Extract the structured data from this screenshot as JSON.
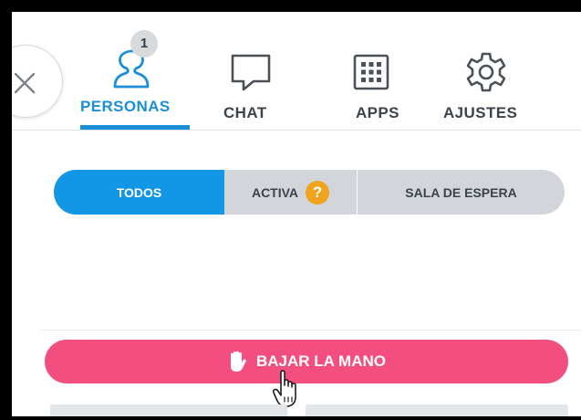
{
  "tabs": [
    {
      "label": "PERSONAS",
      "icon": "person-icon",
      "active": true,
      "badge": "1"
    },
    {
      "label": "CHAT",
      "icon": "chat-bubble-icon",
      "active": false
    },
    {
      "label": "APPS",
      "icon": "apps-grid-icon",
      "active": false
    },
    {
      "label": "AJUSTES",
      "icon": "gear-icon",
      "active": false
    }
  ],
  "filters": [
    {
      "label": "TODOS",
      "active": true
    },
    {
      "label": "ACTIVA",
      "active": false,
      "help_icon": "?"
    },
    {
      "label": "SALA DE ESPERA",
      "active": false
    }
  ],
  "action_button": {
    "label": "BAJAR LA MANO",
    "icon": "raised-hand-icon"
  },
  "colors": {
    "accent_blue": "#1a8fd8",
    "segment_active": "#1296e6",
    "segment_bg": "#d2d6da",
    "help_badge": "#f0a31c",
    "action_pink": "#f24f80",
    "text_dark": "#3c4349"
  }
}
